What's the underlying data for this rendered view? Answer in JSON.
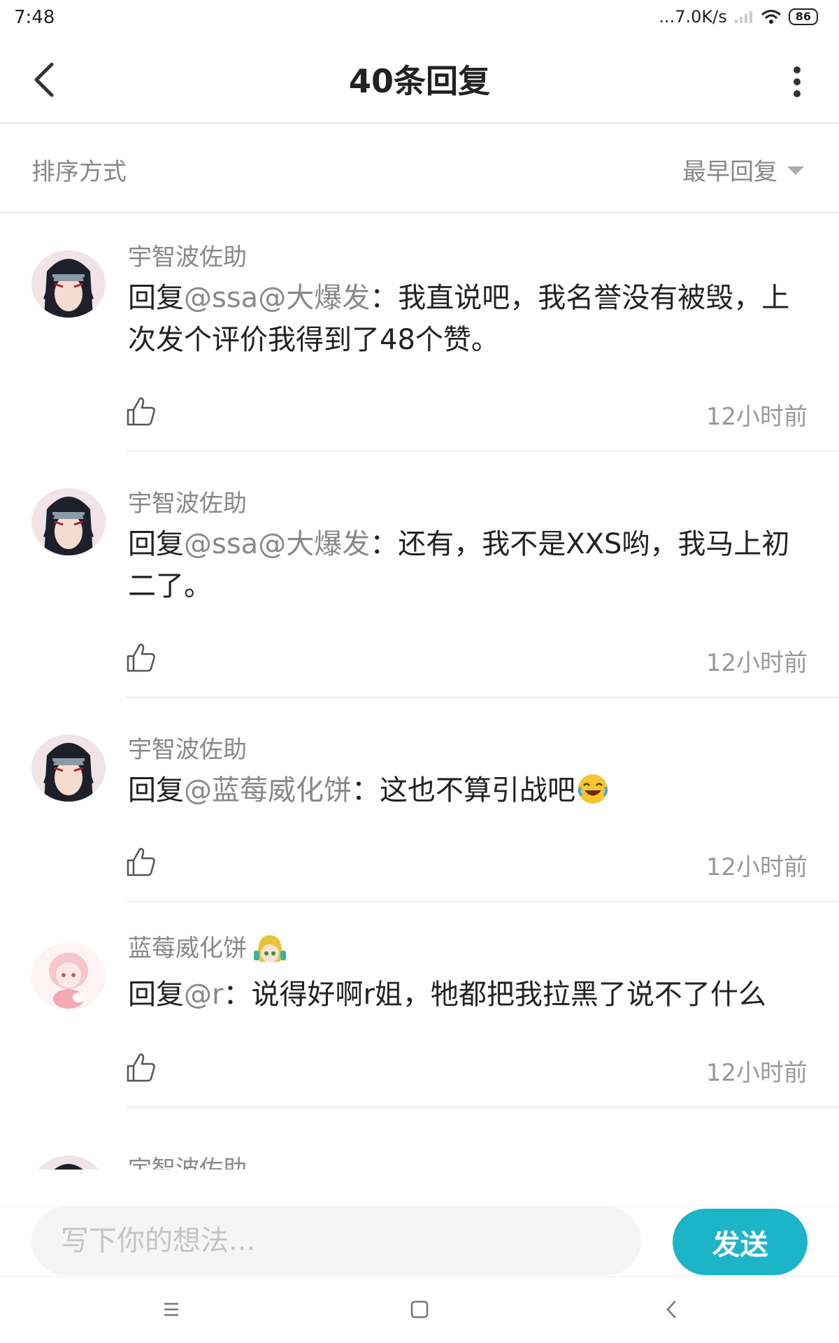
{
  "status_bar": {
    "time": "7:48",
    "net_speed": "...7.0K/s",
    "battery": "86"
  },
  "header": {
    "title": "40条回复"
  },
  "sort": {
    "label": "排序方式",
    "value": "最早回复"
  },
  "replies": [
    {
      "user": "宇智波佐助",
      "prefix": "回复",
      "mention": "@ssa@大爆发",
      "text": "：我直说吧，我名誉没有被毁，上次发个评价我得到了48个赞。",
      "time": "12小时前"
    },
    {
      "user": "宇智波佐助",
      "prefix": "回复",
      "mention": "@ssa@大爆发",
      "text": "：还有，我不是XXS哟，我马上初二了。",
      "time": "12小时前"
    },
    {
      "user": "宇智波佐助",
      "prefix": "回复",
      "mention": "@蓝莓威化饼",
      "text": "：这也不算引战吧",
      "time": "12小时前"
    },
    {
      "user": "蓝莓威化饼",
      "prefix": "回复",
      "mention": "@r",
      "text": "：说得好啊r姐，牠都把我拉黑了说不了什么",
      "time": "12小时前"
    },
    {
      "user": "宇智波佐助"
    }
  ],
  "composer": {
    "placeholder": "写下你的想法...",
    "send_label": "发送"
  },
  "colors": {
    "accent": "#1cb5c7",
    "muted_text": "#888888"
  },
  "icons": [
    "back-icon",
    "more-icon",
    "caret-down-icon",
    "like-icon",
    "laugh-emoji-icon",
    "menu-icon",
    "home-icon",
    "back-nav-icon"
  ]
}
